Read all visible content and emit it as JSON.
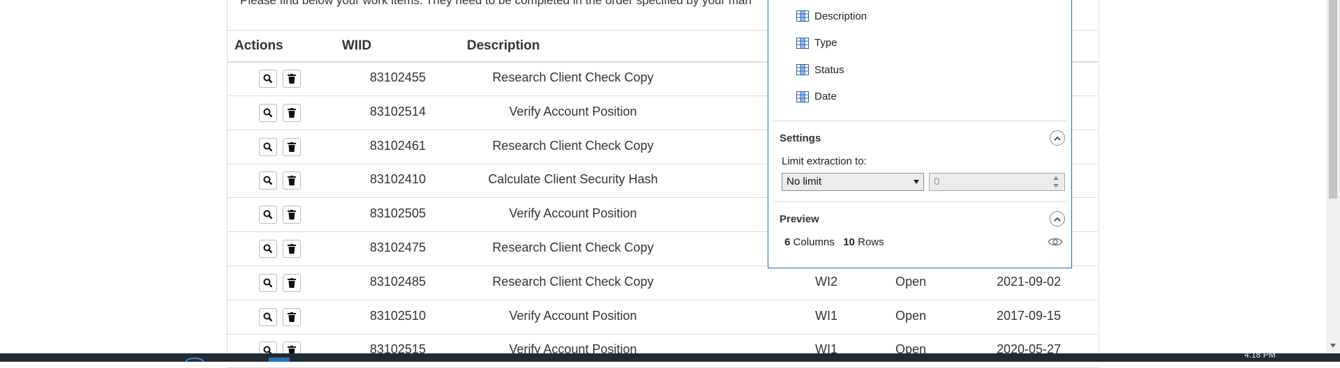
{
  "page": {
    "intro": "Please find below your work items. They need to be completed in the order specified by your man"
  },
  "table": {
    "headers": {
      "actions": "Actions",
      "wiid": "WIID",
      "description": "Description"
    },
    "rows": [
      {
        "wiid": "83102455",
        "description": "Research Client Check Copy",
        "type": "",
        "status": "",
        "date": ""
      },
      {
        "wiid": "83102514",
        "description": "Verify Account Position",
        "type": "",
        "status": "",
        "date": ""
      },
      {
        "wiid": "83102461",
        "description": "Research Client Check Copy",
        "type": "",
        "status": "",
        "date": ""
      },
      {
        "wiid": "83102410",
        "description": "Calculate Client Security Hash",
        "type": "",
        "status": "",
        "date": ""
      },
      {
        "wiid": "83102505",
        "description": "Verify Account Position",
        "type": "",
        "status": "",
        "date": ""
      },
      {
        "wiid": "83102475",
        "description": "Research Client Check Copy",
        "type": "",
        "status": "",
        "date": ""
      },
      {
        "wiid": "83102485",
        "description": "Research Client Check Copy",
        "type": "WI2",
        "status": "Open",
        "date": "2021-09-02"
      },
      {
        "wiid": "83102510",
        "description": "Verify Account Position",
        "type": "WI1",
        "status": "Open",
        "date": "2017-09-15"
      },
      {
        "wiid": "83102515",
        "description": "Verify Account Position",
        "type": "WI1",
        "status": "Open",
        "date": "2020-05-27"
      }
    ]
  },
  "panel": {
    "columns": [
      "Description",
      "Type",
      "Status",
      "Date"
    ],
    "settings_title": "Settings",
    "limit_label": "Limit extraction to:",
    "limit_select": "No limit",
    "limit_number": "0",
    "preview_title": "Preview",
    "preview_columns_count": "6",
    "preview_columns_label": "Columns",
    "preview_rows_count": "10",
    "preview_rows_label": "Rows"
  },
  "colors": {
    "panel_border": "#1f6fc4",
    "column_icon": "#2b5fa8",
    "taskbar": "#202b33"
  },
  "icons": {
    "view": "magnifier-icon",
    "delete": "trash-icon",
    "column": "table-column-icon",
    "collapse": "chevron-up-icon",
    "preview": "eye-icon"
  },
  "taskbar": {
    "clock": "4:18 PM"
  }
}
